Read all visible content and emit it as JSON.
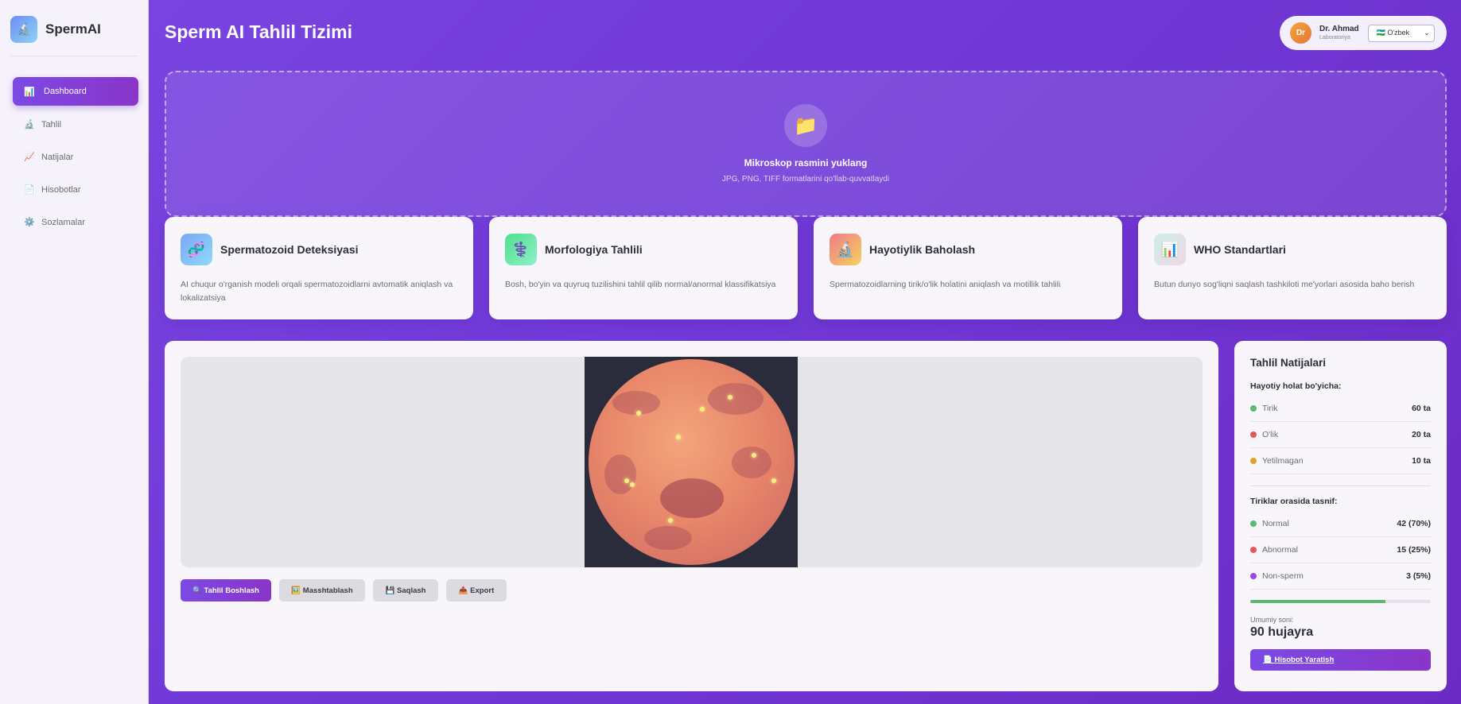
{
  "brand": {
    "name": "SpermAI",
    "logo_icon": "microscope-icon"
  },
  "sidebar": {
    "items": [
      {
        "label": "Dashboard",
        "icon": "bar-chart-icon",
        "glyph": "📊",
        "active": true
      },
      {
        "label": "Tahlil",
        "icon": "microscope-icon",
        "glyph": "🔬",
        "active": false
      },
      {
        "label": "Natijalar",
        "icon": "trend-chart-icon",
        "glyph": "📈",
        "active": false
      },
      {
        "label": "Hisobotlar",
        "icon": "document-icon",
        "glyph": "📄",
        "active": false
      },
      {
        "label": "Sozlamalar",
        "icon": "gear-icon",
        "glyph": "⚙️",
        "active": false
      }
    ]
  },
  "header": {
    "title": "Sperm AI Tahlil Tizimi",
    "user": {
      "initials": "Dr",
      "name": "Dr. Ahmad",
      "role": "Laboratoriya"
    },
    "language": {
      "selected": "🇺🇿 O'zbek"
    }
  },
  "upload": {
    "icon": "folder-icon",
    "glyph": "📁",
    "title": "Mikroskop rasmini yuklang",
    "subtitle": "JPG, PNG, TIFF formatlarini qo'llab-quvvatlaydi"
  },
  "features": [
    {
      "title": "Spermatozoid Deteksiyasi",
      "desc": "AI chuqur o'rganish modeli orqali spermatozoidlarni avtomatik aniqlash va lokalizatsiya",
      "icon": "dna-icon",
      "glyph": "🧬",
      "color": "#7aa7f7"
    },
    {
      "title": "Morfologiya Tahlili",
      "desc": "Bosh, bo'yin va quyruq tuzilishini tahlil qilib normal/anormal klassifikatsiya",
      "icon": "medical-symbol-icon",
      "glyph": "⚕️",
      "color": "#5ee6a8"
    },
    {
      "title": "Hayotiylik Baholash",
      "desc": "Spermatozoidlarning tirik/o'lik holatini aniqlash va motillik tahlili",
      "icon": "microscope-icon",
      "glyph": "🔬",
      "color": "#f3a55e"
    },
    {
      "title": "WHO Standartlari",
      "desc": "Butun dunyo sog'liqni saqlash tashkiloti me'yorlari asosida baho berish",
      "icon": "bar-chart-icon",
      "glyph": "📊",
      "color": "#cfe6ea"
    }
  ],
  "toolbar": {
    "analyze": "🔍 Tahlil Boshlash",
    "zoom": "🖼️ Masshtablash",
    "save": "💾 Saqlash",
    "export": "📤 Export"
  },
  "results": {
    "title": "Tahlil Natijalari",
    "vitality_heading": "Hayotiy holat bo'yicha:",
    "vitality": [
      {
        "label": "Tirik",
        "value": "60 ta",
        "color": "#5cb874"
      },
      {
        "label": "O'lik",
        "value": "20 ta",
        "color": "#e05a5a"
      },
      {
        "label": "Yetilmagan",
        "value": "10 ta",
        "color": "#e0a030"
      }
    ],
    "class_heading": "Tiriklar orasida tasnif:",
    "classification": [
      {
        "label": "Normal",
        "value": "42 (70%)",
        "color": "#5cb874"
      },
      {
        "label": "Abnormal",
        "value": "15 (25%)",
        "color": "#e05a5a"
      },
      {
        "label": "Non-sperm",
        "value": "3 (5%)",
        "color": "#9a4ae4"
      }
    ],
    "progress_fraction": 0.75,
    "total_label": "Umumiy soni:",
    "total_value": "90 hujayra",
    "report_button": "📄 Hisobot Yaratish"
  }
}
